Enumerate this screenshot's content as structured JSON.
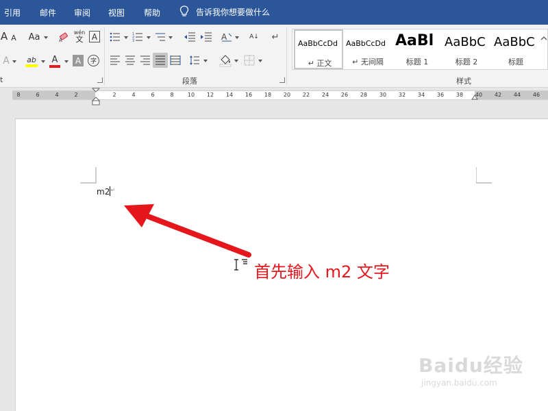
{
  "tabs": [
    "引用",
    "邮件",
    "审阅",
    "视图",
    "帮助"
  ],
  "tell_me": "告诉我你想要做什么",
  "ribbon": {
    "font_size_increase": "A",
    "font_size_decrease": "A",
    "change_case": "Aa",
    "phonetic_top": "wén",
    "phonetic_bottom": "文",
    "char_border": "A",
    "highlight": "ab",
    "font_color": "A",
    "char_shading": "A",
    "enclosed_char": "字",
    "sort": "A↓",
    "group_paragraph": "段落",
    "group_styles": "样式",
    "group_font_partial": "t"
  },
  "styles": [
    {
      "sample": "AaBbCcDd",
      "name": "↵ 正文"
    },
    {
      "sample": "AaBbCcDd",
      "name": "↵ 无间隔"
    },
    {
      "sample": "AaBl",
      "name": "标题 1"
    },
    {
      "sample": "AaBbC",
      "name": "标题 2"
    },
    {
      "sample": "AaBbC",
      "name": "标题"
    }
  ],
  "ruler_numbers": [
    "8",
    "6",
    "4",
    "2",
    "2",
    "4",
    "6",
    "8",
    "10",
    "12",
    "14",
    "16",
    "18",
    "20",
    "22",
    "24",
    "26",
    "28",
    "30",
    "32",
    "34",
    "36",
    "38",
    "40",
    "42",
    "44",
    "46"
  ],
  "document": {
    "text": "m2",
    "paragraph_mark": "↵"
  },
  "annotation": "首先输入 m2  文字",
  "watermark": {
    "logo": "Baidu经验",
    "url": "jingyan.baidu.com"
  },
  "colors": {
    "tabbar": "#2b579a",
    "annotation": "#e5161c",
    "highlight": "#ffff00",
    "font_color": "#e5161c"
  }
}
